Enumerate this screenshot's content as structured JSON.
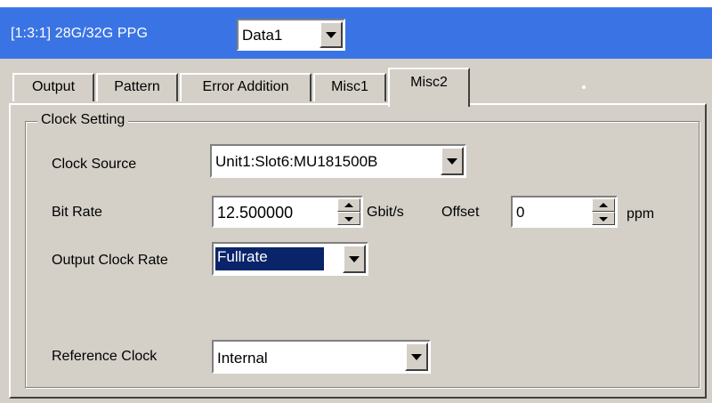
{
  "header": {
    "title": "[1:3:1] 28G/32G PPG",
    "data_select": "Data1"
  },
  "tabs": [
    "Output",
    "Pattern",
    "Error Addition",
    "Misc1",
    "Misc2"
  ],
  "active_tab": "Misc2",
  "clock_setting": {
    "group_label": "Clock Setting",
    "clock_source": {
      "label": "Clock Source",
      "value": "Unit1:Slot6:MU181500B"
    },
    "bit_rate": {
      "label": "Bit Rate",
      "value": "12.500000",
      "unit": "Gbit/s"
    },
    "offset": {
      "label": "Offset",
      "value": "0",
      "unit": "ppm"
    },
    "output_clock_rate": {
      "label": "Output Clock Rate",
      "value": "Fullrate"
    },
    "reference_clock": {
      "label": "Reference Clock",
      "value": "Internal"
    }
  },
  "colors": {
    "header_bg": "#3a74e4",
    "window_bg": "#d4d0c8",
    "selection_bg": "#0a246a"
  }
}
